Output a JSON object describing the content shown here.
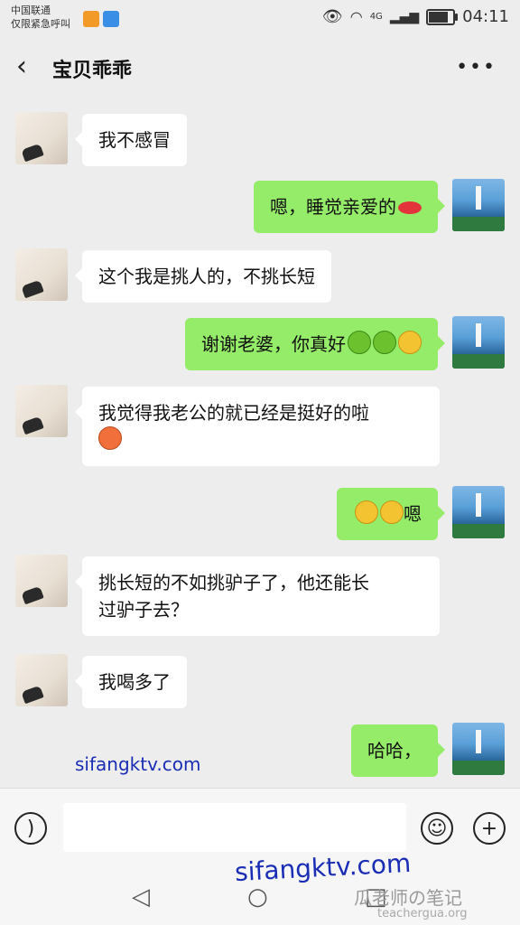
{
  "status": {
    "carrier_line1": "中国联通",
    "carrier_line2": "仅限紧急呼叫",
    "network": "4G",
    "time": "04:11"
  },
  "header": {
    "back_icon": "chevron-left-icon",
    "title": "宝贝乖乖",
    "more_icon": "more-dots-icon"
  },
  "messages": [
    {
      "side": "left",
      "text": "我不感冒"
    },
    {
      "side": "right",
      "text": "嗯，睡觉亲爱的",
      "emojis": [
        "lips"
      ]
    },
    {
      "side": "left",
      "text": "这个我是挑人的，不挑长短"
    },
    {
      "side": "right",
      "text": "谢谢老婆，你真好",
      "emojis": [
        "frog",
        "frog",
        "grin"
      ]
    },
    {
      "side": "left",
      "text_line1": "我觉得我老公的就已经是挺好的啦",
      "emojis": [
        "flushed"
      ]
    },
    {
      "side": "right",
      "text": "嗯",
      "emojis": [
        "grin",
        "grin"
      ]
    },
    {
      "side": "left",
      "text_line1": "挑长短的不如挑驴子了，他还能长",
      "text_line2": "过驴子去？"
    },
    {
      "side": "left",
      "text": "我喝多了"
    },
    {
      "side": "right",
      "text": "哈哈，"
    }
  ],
  "watermarks": {
    "site": "sifangktv.com",
    "site_large": "sifangktv.com",
    "brand": "瓜老师の笔记",
    "brand_url": "teachergua.org"
  },
  "input_bar": {
    "voice_icon": "voice-icon",
    "emoji_icon": "smiley-icon",
    "plus_icon": "plus-icon"
  },
  "nav": {
    "back_icon": "nav-back-icon",
    "home_icon": "nav-home-icon",
    "recent_icon": "nav-recent-icon"
  },
  "battery_level": 0.85
}
